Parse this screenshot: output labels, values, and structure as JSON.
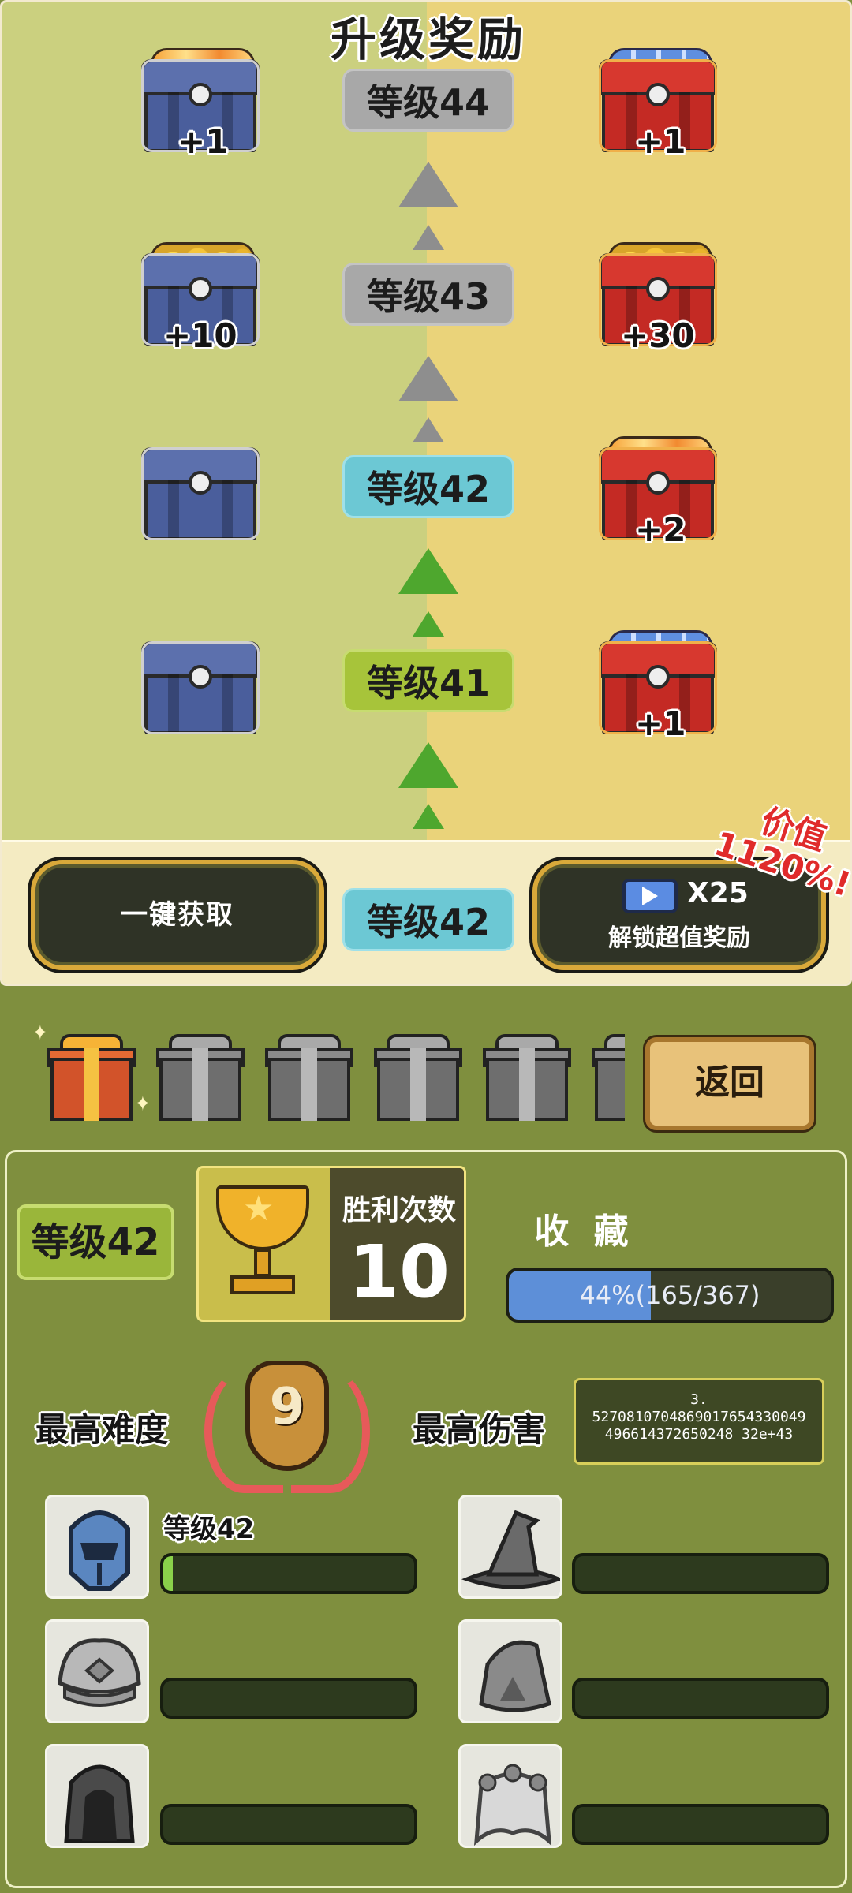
{
  "title": "升级奖励",
  "levels": [
    {
      "label": "等级44",
      "state": "locked",
      "free": {
        "type": "gems",
        "qty": "+1"
      },
      "premium": {
        "type": "tickets",
        "qty": "+1"
      }
    },
    {
      "label": "等级43",
      "state": "locked",
      "free": {
        "type": "coins",
        "qty": "+10"
      },
      "premium": {
        "type": "coins",
        "qty": "+30"
      }
    },
    {
      "label": "等级42",
      "state": "current",
      "free": {
        "type": "empty",
        "qty": ""
      },
      "premium": {
        "type": "gems",
        "qty": "+2"
      }
    },
    {
      "label": "等级41",
      "state": "reached",
      "free": {
        "type": "empty",
        "qty": ""
      },
      "premium": {
        "type": "tickets",
        "qty": "+1"
      }
    }
  ],
  "claim_bar": {
    "claim_all": "一键获取",
    "current_level": "等级42",
    "unlock_count": "X25",
    "unlock_label": "解锁超值奖励",
    "value_tag": "价值\n1120%!"
  },
  "gifts": {
    "count_total": 6,
    "opened": 1
  },
  "back_button": "返回",
  "stats": {
    "level": "等级42",
    "wins_label": "胜利次数",
    "wins_value": "10",
    "collection_label": "收 藏",
    "collection_percent": 44,
    "collection_text": "44%(165/367)",
    "max_difficulty_label": "最高难度",
    "max_difficulty_value": "9",
    "max_damage_label": "最高伤害",
    "max_damage_value": "3.\n527081070486901765433004\n9496614372650248 32e+43"
  },
  "heroes": [
    {
      "name": "knight-helmet",
      "level": "等级42",
      "progress": 0.02,
      "unlocked": true
    },
    {
      "name": "witch-hat",
      "level": "",
      "progress": 0,
      "unlocked": false
    },
    {
      "name": "turban",
      "level": "",
      "progress": 0,
      "unlocked": false
    },
    {
      "name": "ranger-hood",
      "level": "",
      "progress": 0,
      "unlocked": false
    },
    {
      "name": "dark-hood",
      "level": "",
      "progress": 0,
      "unlocked": false
    },
    {
      "name": "flower-veil",
      "level": "",
      "progress": 0,
      "unlocked": false
    }
  ],
  "colors": {
    "accent_gold": "#d9a93a",
    "progress_blue": "#5d8fd8",
    "level_teal": "#6cc8d4",
    "level_green": "#a7c43a"
  }
}
